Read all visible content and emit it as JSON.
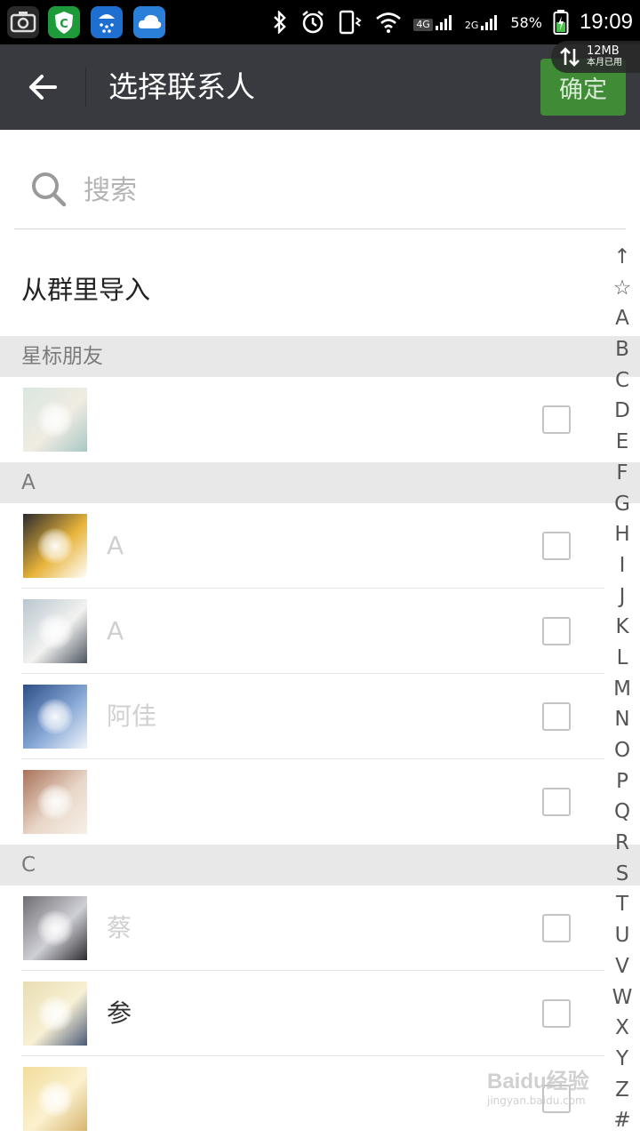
{
  "status_bar": {
    "network_4g": "4G",
    "network_2g": "2G",
    "battery_percent": "58%",
    "time": "19:09",
    "traffic_amount": "12MB",
    "traffic_label": "本月已用",
    "icons": [
      "screenshot-icon",
      "security-app-icon",
      "shower-app-icon",
      "cloud-app-icon",
      "bluetooth-icon",
      "alarm-icon",
      "phone-vibrate-icon",
      "wifi-icon",
      "battery-icon"
    ]
  },
  "toolbar": {
    "title": "选择联系人",
    "confirm_label": "确定"
  },
  "search": {
    "placeholder": "搜索"
  },
  "import_from_group": "从群里导入",
  "sections": [
    {
      "header": "星标朋友",
      "contacts": [
        {
          "name": "",
          "checked": false,
          "avatar_colors": [
            "#d9e7e0",
            "#f0ece2",
            "#a9c7c4"
          ]
        }
      ]
    },
    {
      "header": "A",
      "contacts": [
        {
          "name": "A",
          "checked": false,
          "avatar_colors": [
            "#2b2b2b",
            "#e8b43a",
            "#ffffff"
          ]
        },
        {
          "name": "A",
          "checked": false,
          "avatar_colors": [
            "#b9c6cf",
            "#f2f2f0",
            "#4c5560"
          ]
        },
        {
          "name": "阿佳",
          "checked": false,
          "avatar_colors": [
            "#2c4f86",
            "#87a8d6",
            "#f0f4fa"
          ]
        },
        {
          "name": "",
          "checked": false,
          "avatar_colors": [
            "#a8725a",
            "#e9d7c8",
            "#f6f0ea"
          ]
        }
      ]
    },
    {
      "header": "C",
      "contacts": [
        {
          "name": "蔡",
          "checked": false,
          "avatar_colors": [
            "#6e6e72",
            "#cfcfd6",
            "#2c2c30"
          ]
        },
        {
          "name": "参",
          "checked": false,
          "avatar_colors": [
            "#e9ddb2",
            "#f7f0d4",
            "#4a5a78"
          ]
        },
        {
          "name": "",
          "checked": false,
          "avatar_colors": [
            "#f2dc9a",
            "#fbf1cf",
            "#d7b46e"
          ]
        }
      ]
    }
  ],
  "index_bar": [
    "↑",
    "☆",
    "A",
    "B",
    "C",
    "D",
    "E",
    "F",
    "G",
    "H",
    "I",
    "J",
    "K",
    "L",
    "M",
    "N",
    "O",
    "P",
    "Q",
    "R",
    "S",
    "T",
    "U",
    "V",
    "W",
    "X",
    "Y",
    "Z",
    "#"
  ],
  "watermark": {
    "main": "Baidu经验",
    "sub": "jingyan.baidu.com"
  },
  "colors": {
    "toolbar_bg": "#393a3f",
    "confirm_bg": "#3f8b36",
    "section_header_bg": "#e8e8e8",
    "checkbox_border": "#c4c4c4"
  }
}
